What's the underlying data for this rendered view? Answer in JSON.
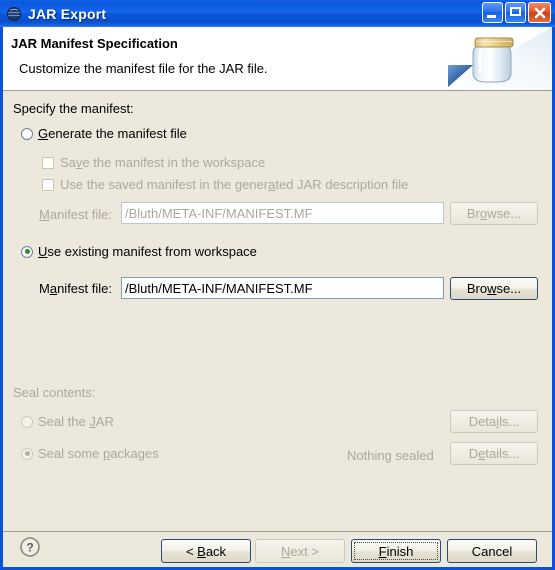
{
  "window": {
    "title": "JAR Export",
    "icon": "jar-export-icon",
    "controls": {
      "minimize": "minimize-button",
      "maximize": "maximize-button",
      "close": "close-button"
    }
  },
  "header": {
    "title": "JAR Manifest Specification",
    "subtitle": "Customize the manifest file for the JAR file.",
    "art_icon": "jar-illustration"
  },
  "body": {
    "specify_label": "Specify the manifest:",
    "generate_option": {
      "label": "Generate the manifest file",
      "selected": false,
      "enabled": true
    },
    "save_workspace_checkbox": {
      "label": "Save the manifest in the workspace",
      "checked": false,
      "enabled": false
    },
    "use_saved_checkbox": {
      "label": "Use the saved manifest in the generated JAR description file",
      "checked": false,
      "enabled": false
    },
    "generate_manifest_file": {
      "label": "Manifest file:",
      "value": "/Bluth/META-INF/MANIFEST.MF",
      "browse_label": "Browse...",
      "enabled": false
    },
    "existing_option": {
      "label": "Use existing manifest from workspace",
      "selected": true,
      "enabled": true
    },
    "existing_manifest_file": {
      "label": "Manifest file:",
      "value": "/Bluth/META-INF/MANIFEST.MF",
      "browse_label": "Browse...",
      "enabled": true
    },
    "seal_section": {
      "label": "Seal contents:",
      "seal_jar": {
        "label": "Seal the JAR",
        "selected": false,
        "details_label": "Details..."
      },
      "seal_packages": {
        "label": "Seal some packages",
        "selected": true,
        "status": "Nothing sealed",
        "details_label": "Details..."
      }
    }
  },
  "footer": {
    "help_icon": "help-question-icon",
    "back_label": "< Back",
    "next_label": "Next >",
    "finish_label": "Finish",
    "cancel_label": "Cancel"
  },
  "colors": {
    "titlebar_blue": "#0b57dd",
    "dialog_bg": "#ece9dc",
    "disabled_text": "#aca899",
    "field_border": "#7f9db9",
    "radio_dot_green": "#2e8b2e"
  }
}
